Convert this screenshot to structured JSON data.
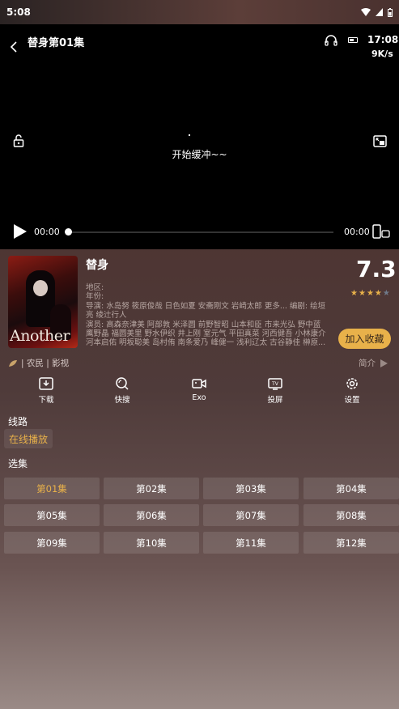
{
  "status_bar": {
    "time": "5:08"
  },
  "player": {
    "title": "替身第01集",
    "clock": "17:08",
    "speed": "9K/s",
    "buffer_text": "开始缓冲~~",
    "current_time": "00:00",
    "duration": "00:00",
    "progress": 0
  },
  "show": {
    "title": "替身",
    "poster_logo": "Another",
    "score": "7.3",
    "rating_stars": 3.5,
    "region": "地区:",
    "year": "年份:",
    "director_line": "导演: 水岛努 筱原俊哉 日色如夏 安斋刚文 岩崎太郎 更多... 编剧: 绘垣",
    "director_line2": "亮 绫辻行人",
    "cast_line1": "演员: 高森奈津美 阿部敦 米泽圆 前野智昭 山本和臣 市来光弘 野中蓝",
    "cast_line2": "鹰野晶 福圆美里 野水伊织 井上刚 室元气 平田真菜 河西健吾 小林康介",
    "cast_line3": "河本启佑 明坂聪美 岛村侑 南条爱乃 峰健一 浅利辽太 古谷静佳 榊原...",
    "favorite_label": "加入收藏",
    "tags": "| 农民 | 影视",
    "intro_label": "简介"
  },
  "actions": [
    {
      "label": "下载",
      "icon": "download-icon"
    },
    {
      "label": "快搜",
      "icon": "search-icon"
    },
    {
      "label": "Exo",
      "icon": "camera-icon"
    },
    {
      "label": "投屏",
      "icon": "tv-icon"
    },
    {
      "label": "设置",
      "icon": "gear-icon"
    }
  ],
  "route": {
    "label": "线路",
    "source": "在线播放"
  },
  "episodes": {
    "label": "选集",
    "items": [
      "第01集",
      "第02集",
      "第03集",
      "第04集",
      "第05集",
      "第06集",
      "第07集",
      "第08集",
      "第09集",
      "第10集",
      "第11集",
      "第12集"
    ],
    "active_index": 0
  },
  "colors": {
    "accent": "#e8b14a",
    "player_bg": "#000000"
  }
}
